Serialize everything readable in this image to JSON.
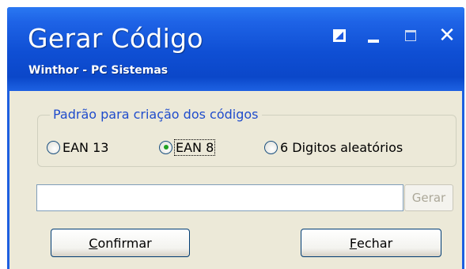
{
  "window": {
    "title": "Gerar Código",
    "subtitle": "Winthor - PC Sistemas"
  },
  "group": {
    "legend": "Padrão para criação dos códigos",
    "options": [
      {
        "label": "EAN 13",
        "selected": false
      },
      {
        "label": "EAN 8",
        "selected": true
      },
      {
        "label": "6 Digitos aleatórios",
        "selected": false
      }
    ]
  },
  "code_input": {
    "value": "",
    "placeholder": ""
  },
  "buttons": {
    "gerar": "Gerar",
    "confirm_first": "C",
    "confirm_rest": "onfirmar",
    "close_first": "F",
    "close_rest": "echar"
  },
  "icons": {
    "restore": "restore-icon",
    "minimize": "minimize-icon",
    "maximize": "maximize-icon",
    "close": "close-icon"
  },
  "colors": {
    "titlebar": "#0f4fd4",
    "dialog_bg": "#ece9d8",
    "legend_text": "#1f4ccc",
    "radio_checked": "#21a121"
  }
}
